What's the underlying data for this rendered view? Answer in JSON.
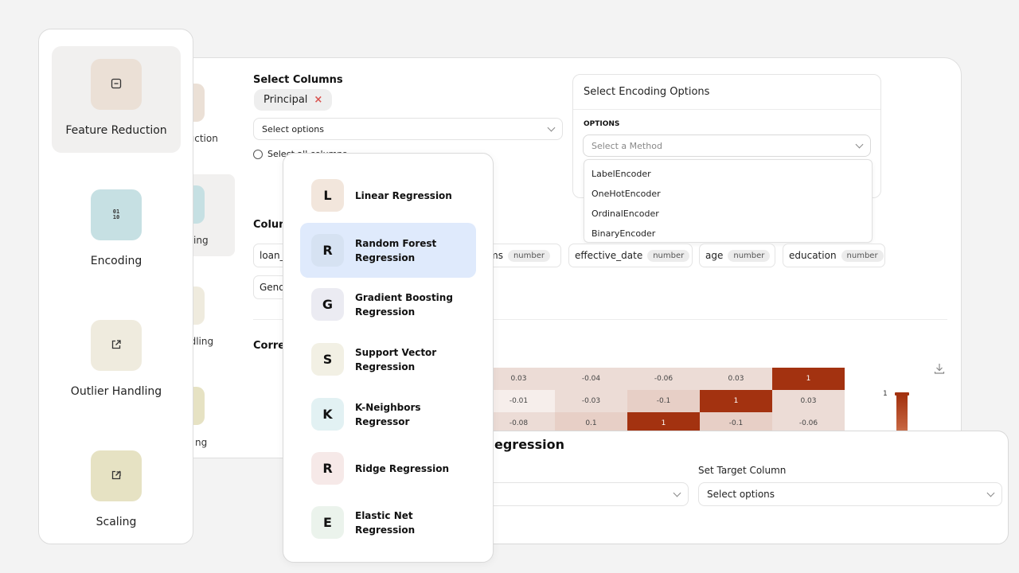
{
  "sidebar": {
    "items": [
      {
        "label": "Feature Reduction",
        "icon": "minus-square-icon",
        "color": "#ebe0d6"
      },
      {
        "label": "Encoding",
        "icon": "binary-icon",
        "glyph": "01\n10",
        "color": "#c6e0e3"
      },
      {
        "label": "Outlier Handling",
        "icon": "external-link-icon",
        "color": "#efebde"
      },
      {
        "label": "Scaling",
        "icon": "resize-icon",
        "color": "#e6e2c3"
      }
    ],
    "peek_labels": [
      "duction",
      "ing",
      "ndling",
      "ng"
    ]
  },
  "select_columns": {
    "title": "Select Columns",
    "selected_chip": "Principal",
    "remove_glyph": "×",
    "placeholder": "Select options",
    "select_all_label": "Select all columns"
  },
  "encoding": {
    "title": "Select Encoding Options",
    "options_label": "OPTIONS",
    "placeholder": "Select a Method",
    "methods": [
      "LabelEncoder",
      "OneHotEncoder",
      "OrdinalEncoder",
      "BinaryEncoder"
    ]
  },
  "columns_section": {
    "title_partial": "Colum",
    "chips": [
      {
        "name": "loan_",
        "type": ""
      },
      {
        "name": "ms",
        "type": "number"
      },
      {
        "name": "effective_date",
        "type": "number"
      },
      {
        "name": "age",
        "type": "number"
      },
      {
        "name": "education",
        "type": "number"
      },
      {
        "name": "Gend",
        "type": ""
      }
    ]
  },
  "correlation": {
    "title_partial": "Corre",
    "scale_max_label": "1",
    "rows": [
      [
        "0.03",
        "-0.04",
        "-0.06",
        "0.03",
        "1"
      ],
      [
        "-0.01",
        "-0.03",
        "-0.1",
        "1",
        "0.03"
      ],
      [
        "-0.08",
        "0.1",
        "1",
        "-0.1",
        "-0.06"
      ]
    ],
    "colors": {
      "strong": "#a33210",
      "light": "#ecdcd6",
      "faint": "#f6eeeb",
      "mid": "#e7cfc6"
    }
  },
  "regression_models": {
    "items": [
      {
        "letter": "L",
        "label": "Linear Regression",
        "color": "#f2e6dc",
        "selected": false
      },
      {
        "letter": "R",
        "label": "Random Forest Regression",
        "color": "#d6e2f2",
        "selected": true
      },
      {
        "letter": "G",
        "label": "Gradient Boosting Regression",
        "color": "#ebebf2",
        "selected": false
      },
      {
        "letter": "S",
        "label": "Support Vector Regression",
        "color": "#f2f0e4",
        "selected": false
      },
      {
        "letter": "K",
        "label": "K-Neighbors Regressor",
        "color": "#e2f1f3",
        "selected": false
      },
      {
        "letter": "R",
        "label": "Ridge Regression",
        "color": "#f6e9e8",
        "selected": false
      },
      {
        "letter": "E",
        "label": "Elastic Net Regression",
        "color": "#ebf3ec",
        "selected": false
      }
    ]
  },
  "regression_panel": {
    "title_partial": "egression",
    "target_label": "Set Target Column",
    "target_placeholder": "Select options"
  }
}
